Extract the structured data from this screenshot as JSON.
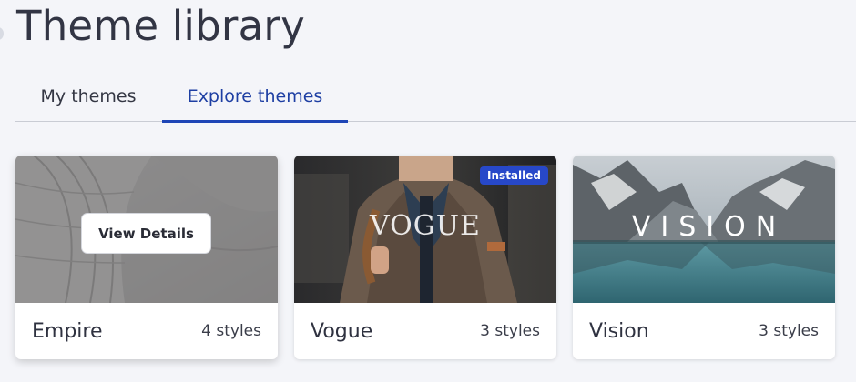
{
  "header": {
    "title": "Theme library"
  },
  "tabs": [
    {
      "label": "My themes",
      "active": false
    },
    {
      "label": "Explore themes",
      "active": true
    }
  ],
  "themes": [
    {
      "name": "Empire",
      "styles": "4 styles",
      "hover_action": "View Details",
      "thumbnail_icon": "architecture-image"
    },
    {
      "name": "Vogue",
      "styles": "3 styles",
      "badge": "Installed",
      "brand_text": "VOGUE",
      "thumbnail_icon": "fashion-portrait-image"
    },
    {
      "name": "Vision",
      "styles": "3 styles",
      "brand_text": "VISION",
      "thumbnail_icon": "mountain-lake-image"
    }
  ],
  "colors": {
    "accent": "#1e45b6",
    "badge": "#2748c9",
    "background": "#f4f5f9"
  }
}
